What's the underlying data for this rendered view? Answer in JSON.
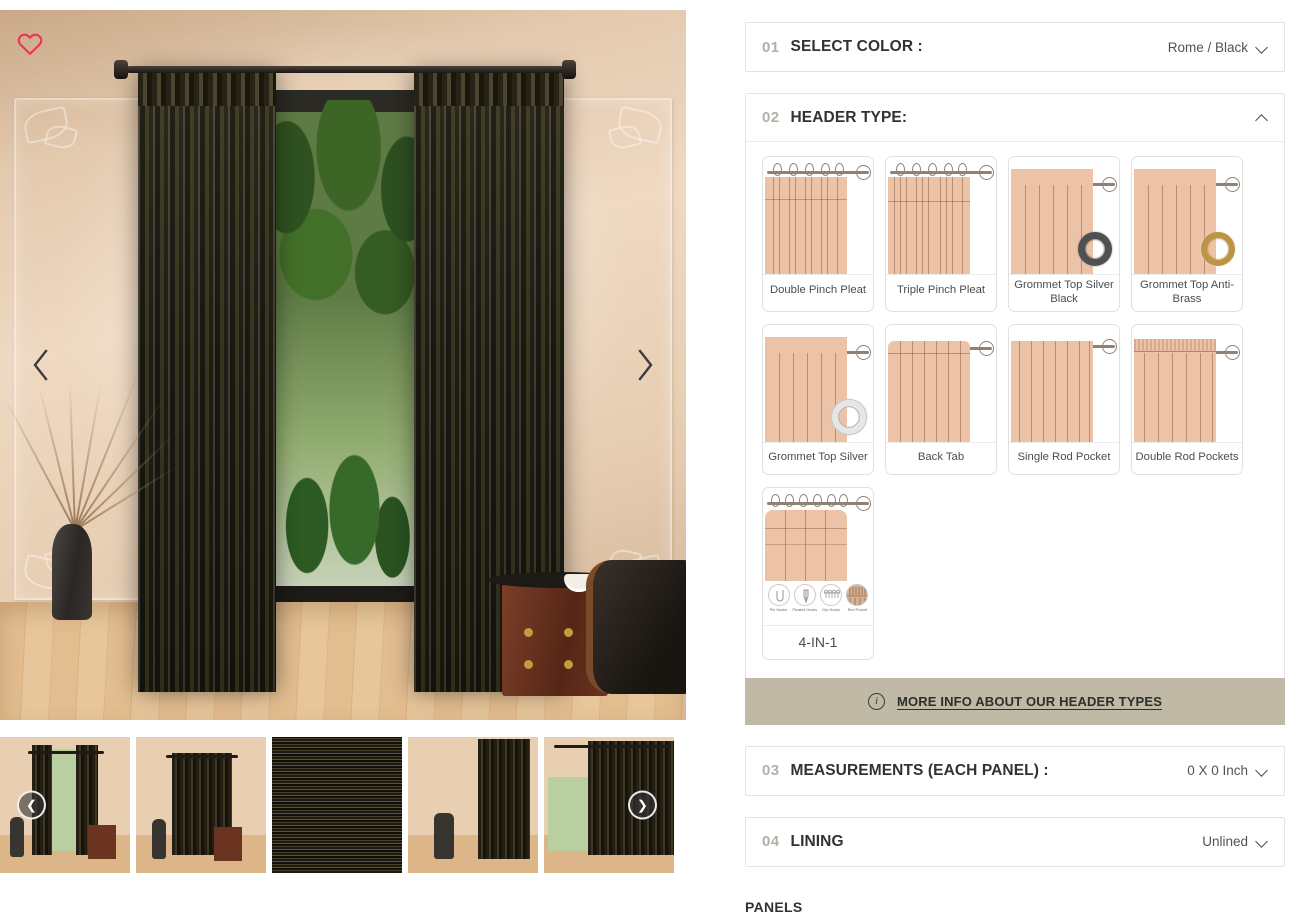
{
  "gallery": {
    "wishlist_icon": "heart-icon",
    "prev_label": "‹",
    "next_label": "›",
    "thumb_prev_label": "❮",
    "thumb_next_label": "❯",
    "thumbnails": [
      {
        "alt": "Black silk curtain panels on window with plants"
      },
      {
        "alt": "Black curtain panel drawn over window in living room"
      },
      {
        "alt": "Close-up fabric swatch Rome Black textured weave"
      },
      {
        "alt": "Dark vase with branches beside black curtain"
      },
      {
        "alt": "Black pleated curtain panel beside window"
      }
    ]
  },
  "config": {
    "sections": [
      {
        "num": "01",
        "title": "SELECT COLOR :",
        "value": "Rome / Black",
        "state": "collapsed",
        "chevron": "chevron-down-icon"
      },
      {
        "num": "02",
        "title": "HEADER TYPE:",
        "value": "",
        "state": "expanded",
        "chevron": "chevron-up-icon"
      },
      {
        "num": "03",
        "title": "MEASUREMENTS (EACH PANEL) :",
        "value": "0 X 0 Inch",
        "state": "collapsed",
        "chevron": "chevron-down-icon"
      },
      {
        "num": "04",
        "title": "LINING",
        "value": "Unlined",
        "state": "collapsed",
        "chevron": "chevron-down-icon"
      }
    ],
    "header_types": [
      {
        "label": "Double Pinch Pleat",
        "art": "pinch-double"
      },
      {
        "label": "Triple Pinch Pleat",
        "art": "pinch-triple"
      },
      {
        "label": "Grommet Top Silver Black",
        "art": "grommet-black"
      },
      {
        "label": "Grommet Top Anti-Brass",
        "art": "grommet-brass"
      },
      {
        "label": "Grommet Top Silver",
        "art": "grommet-silver"
      },
      {
        "label": "Back Tab",
        "art": "back-tab"
      },
      {
        "label": "Single Rod Pocket",
        "art": "single-rod-pocket"
      },
      {
        "label": "Double Rod Pockets",
        "art": "double-rod-pocket"
      },
      {
        "label": "4-IN-1",
        "art": "four-in-one"
      }
    ],
    "four_in_one_icons": [
      {
        "label": "Pin Hooks",
        "icon": "pin-hook-icon"
      },
      {
        "label": "Pleated Hooks",
        "icon": "pleated-hook-icon"
      },
      {
        "label": "Clip Hooks",
        "icon": "clip-hook-icon"
      },
      {
        "label": "Rod Pocket",
        "icon": "rod-pocket-icon"
      }
    ],
    "info_bar": {
      "icon": "info-icon",
      "text": "MORE INFO ABOUT OUR HEADER TYPES"
    },
    "panels_label": "PANELS"
  },
  "colors": {
    "accent_heart": "#ee3355",
    "info_bar_bg": "#bfb9a6",
    "num_color": "#b3b1a6",
    "title_color": "#2f3237",
    "fabric": "#edc3a8"
  }
}
